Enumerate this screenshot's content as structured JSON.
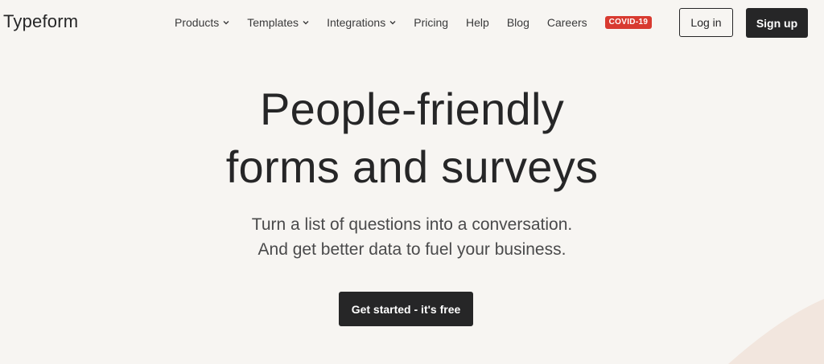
{
  "header": {
    "logo": "Typeform",
    "nav": [
      {
        "label": "Products",
        "has_dropdown": true
      },
      {
        "label": "Templates",
        "has_dropdown": true
      },
      {
        "label": "Integrations",
        "has_dropdown": true
      },
      {
        "label": "Pricing",
        "has_dropdown": false
      },
      {
        "label": "Help",
        "has_dropdown": false
      },
      {
        "label": "Blog",
        "has_dropdown": false
      },
      {
        "label": "Careers",
        "has_dropdown": false
      }
    ],
    "badge": "COVID-19",
    "login_label": "Log in",
    "signup_label": "Sign up"
  },
  "hero": {
    "title_line1": "People-friendly",
    "title_line2": "forms and surveys",
    "subtitle_line1": "Turn a list of questions into a conversation.",
    "subtitle_line2": "And get better data to fuel your business.",
    "cta_label": "Get started - it's free"
  },
  "colors": {
    "background": "#f7f5f2",
    "text": "#262627",
    "button_dark": "#262627",
    "badge": "#d83a30",
    "decor_shape": "#f1e4dc"
  },
  "icons": {
    "dropdown": "chevron-down-icon"
  }
}
